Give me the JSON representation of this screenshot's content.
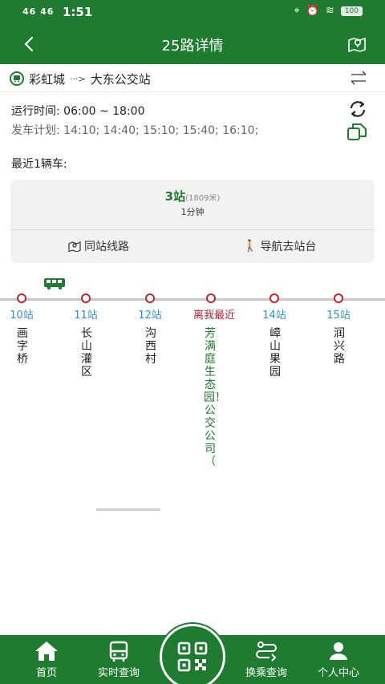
{
  "status_bar": {
    "time": "1:51",
    "signal": "46 46",
    "battery": "100"
  },
  "header": {
    "title": "25路详情",
    "back_icon": "chevron-left-icon",
    "map_icon": "map-pin-icon"
  },
  "route": {
    "from": "彩虹城",
    "arrow": "···>",
    "to": "大东公交站"
  },
  "schedule": {
    "run_time": "运行时间: 06:00 ~ 18:00",
    "plan": "发车计划: 14:10; 14:40; 15:10; 15:40; 16:10;"
  },
  "recent_label": "最近1辆车:",
  "arrival": {
    "stations": "3站",
    "distance": "(1809米)",
    "minutes": "1分钟",
    "same_station_label": "同站线路",
    "navigate_label": "导航去站台"
  },
  "stops": [
    {
      "num": "10站",
      "name": "画字桥"
    },
    {
      "num": "11站",
      "name": "长山灌区"
    },
    {
      "num": "12站",
      "name": "沟西村"
    },
    {
      "num": "离我最近",
      "name": "芳满庭生态园！公交公司（"
    },
    {
      "num": "14站",
      "name": "嶂山果园"
    },
    {
      "num": "15站",
      "name": "润兴路"
    }
  ],
  "tabs": {
    "home": "首页",
    "realtime": "实时查询",
    "transfer": "换乘查询",
    "profile": "个人中心"
  },
  "colors": {
    "brand": "#1e7b2f",
    "stop_ring": "#c0232d",
    "stop_num": "#2a8fc6",
    "nearest": "#b0232d"
  }
}
